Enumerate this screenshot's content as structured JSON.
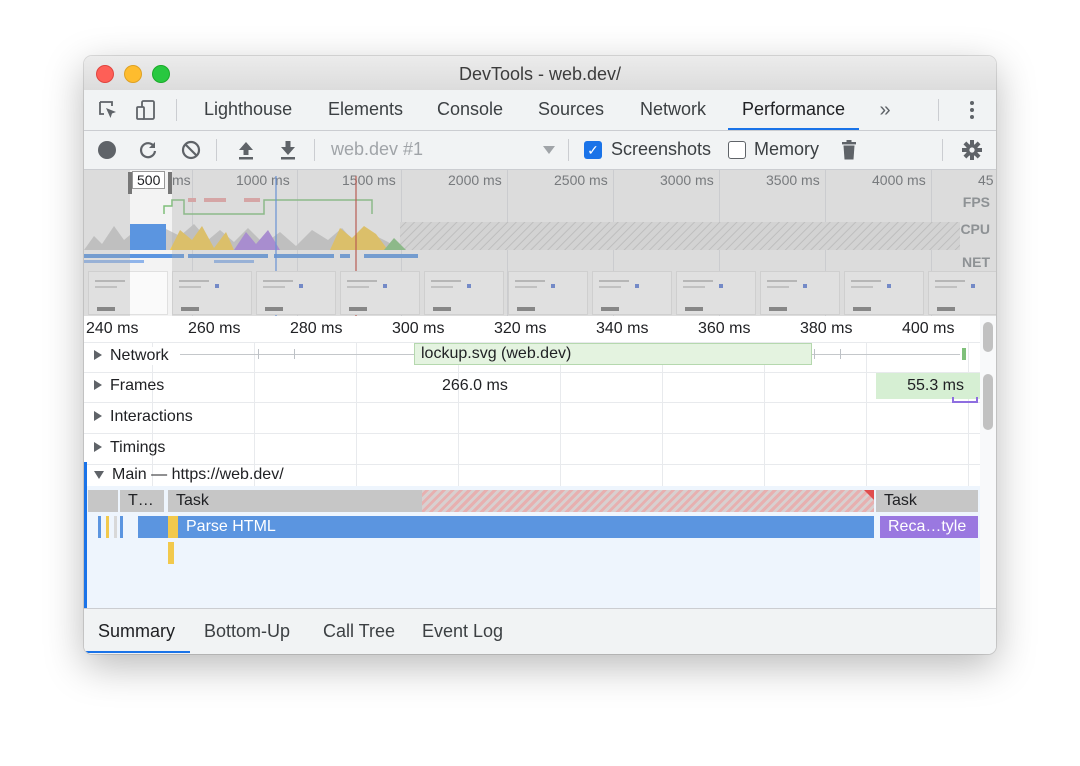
{
  "window": {
    "title": "DevTools - web.dev/"
  },
  "tabs": [
    "Lighthouse",
    "Elements",
    "Console",
    "Sources",
    "Network",
    "Performance"
  ],
  "toolbar": {
    "profile_select": "web.dev #1",
    "screenshots_label": "Screenshots",
    "screenshots_checked": true,
    "memory_label": "Memory",
    "memory_checked": false
  },
  "overview": {
    "ticks": [
      "500",
      "ms",
      "1000 ms",
      "1500 ms",
      "2000 ms",
      "2500 ms",
      "3000 ms",
      "3500 ms",
      "4000 ms",
      "45"
    ],
    "lanes": [
      "FPS",
      "CPU",
      "NET"
    ]
  },
  "ruler": {
    "ticks": [
      "240 ms",
      "260 ms",
      "280 ms",
      "300 ms",
      "320 ms",
      "340 ms",
      "360 ms",
      "380 ms",
      "400 ms"
    ]
  },
  "tracks": {
    "network": "Network",
    "network_request": "lockup.svg (web.dev)",
    "frames": "Frames",
    "frame_1": "266.0 ms",
    "frame_2": "55.3 ms",
    "interactions": "Interactions",
    "timings": "Timings",
    "main": "Main — https://web.dev/"
  },
  "flame": {
    "short_task": "T…",
    "task_1": "Task",
    "task_2": "Task",
    "parse_html": "Parse HTML",
    "recalc_style": "Reca…tyle"
  },
  "bottom_tabs": [
    "Summary",
    "Bottom-Up",
    "Call Tree",
    "Event Log"
  ],
  "colors": {
    "accent": "#1a73e8",
    "task_gray": "#c6c6c6",
    "parse_blue": "#5b95e0",
    "recalc_purple": "#9a78e0",
    "network_green": "#e4f3e0",
    "frame_green": "#d6efd3",
    "long_task_red": "#e04c4c"
  }
}
